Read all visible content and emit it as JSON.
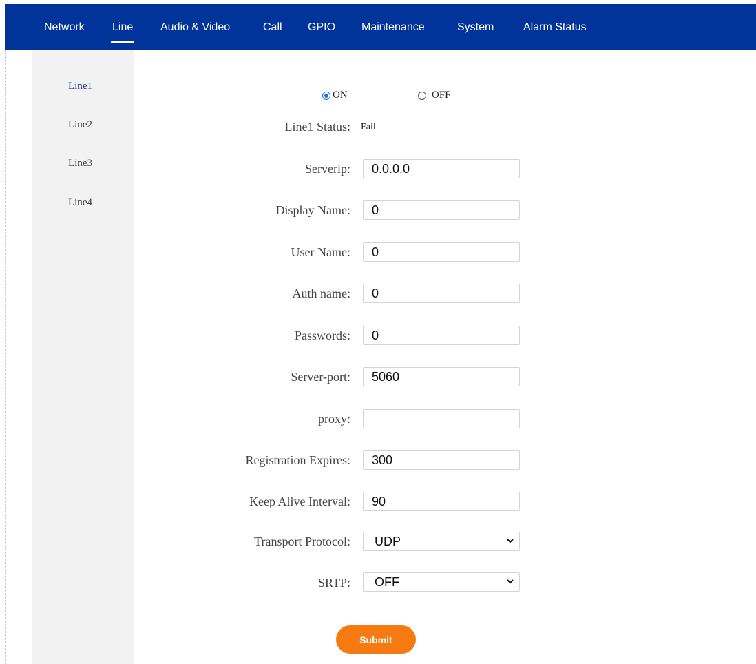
{
  "nav": {
    "items": [
      {
        "label": "Network"
      },
      {
        "label": "Line",
        "active": true
      },
      {
        "label": "Audio & Video"
      },
      {
        "label": "Call"
      },
      {
        "label": "GPIO"
      },
      {
        "label": "Maintenance"
      },
      {
        "label": "System"
      },
      {
        "label": "Alarm Status"
      }
    ]
  },
  "sidebar": {
    "items": [
      {
        "label": "Line1",
        "active": true
      },
      {
        "label": "Line2"
      },
      {
        "label": "Line3"
      },
      {
        "label": "Line4"
      }
    ]
  },
  "form": {
    "enable": {
      "on_label": "ON",
      "off_label": "OFF",
      "selected": "ON"
    },
    "status": {
      "label": "Line1 Status:",
      "value": "Fail"
    },
    "serverip": {
      "label": "Serverip:",
      "value": "0.0.0.0"
    },
    "display_name": {
      "label": "Display Name:",
      "value": "0"
    },
    "user_name": {
      "label": "User Name:",
      "value": "0"
    },
    "auth_name": {
      "label": "Auth name:",
      "value": "0"
    },
    "passwords": {
      "label": "Passwords:",
      "value": "0"
    },
    "server_port": {
      "label": "Server-port:",
      "value": "5060"
    },
    "proxy": {
      "label": "proxy:",
      "value": ""
    },
    "registration_expires": {
      "label": "Registration Expires:",
      "value": "300"
    },
    "keep_alive_interval": {
      "label": "Keep Alive Interval:",
      "value": "90"
    },
    "transport_protocol": {
      "label": "Transport Protocol:",
      "value": "UDP"
    },
    "srtp": {
      "label": "SRTP:",
      "value": "OFF"
    },
    "submit_label": "Submit"
  },
  "colors": {
    "nav_bg": "#00349a",
    "sidebar_bg": "#f2f2f2",
    "submit_bg": "#f47a11",
    "radio_accent": "#1a73e8",
    "active_link": "#1a3c9e"
  },
  "icons": {
    "select_arrow": "chevron-down-icon"
  }
}
